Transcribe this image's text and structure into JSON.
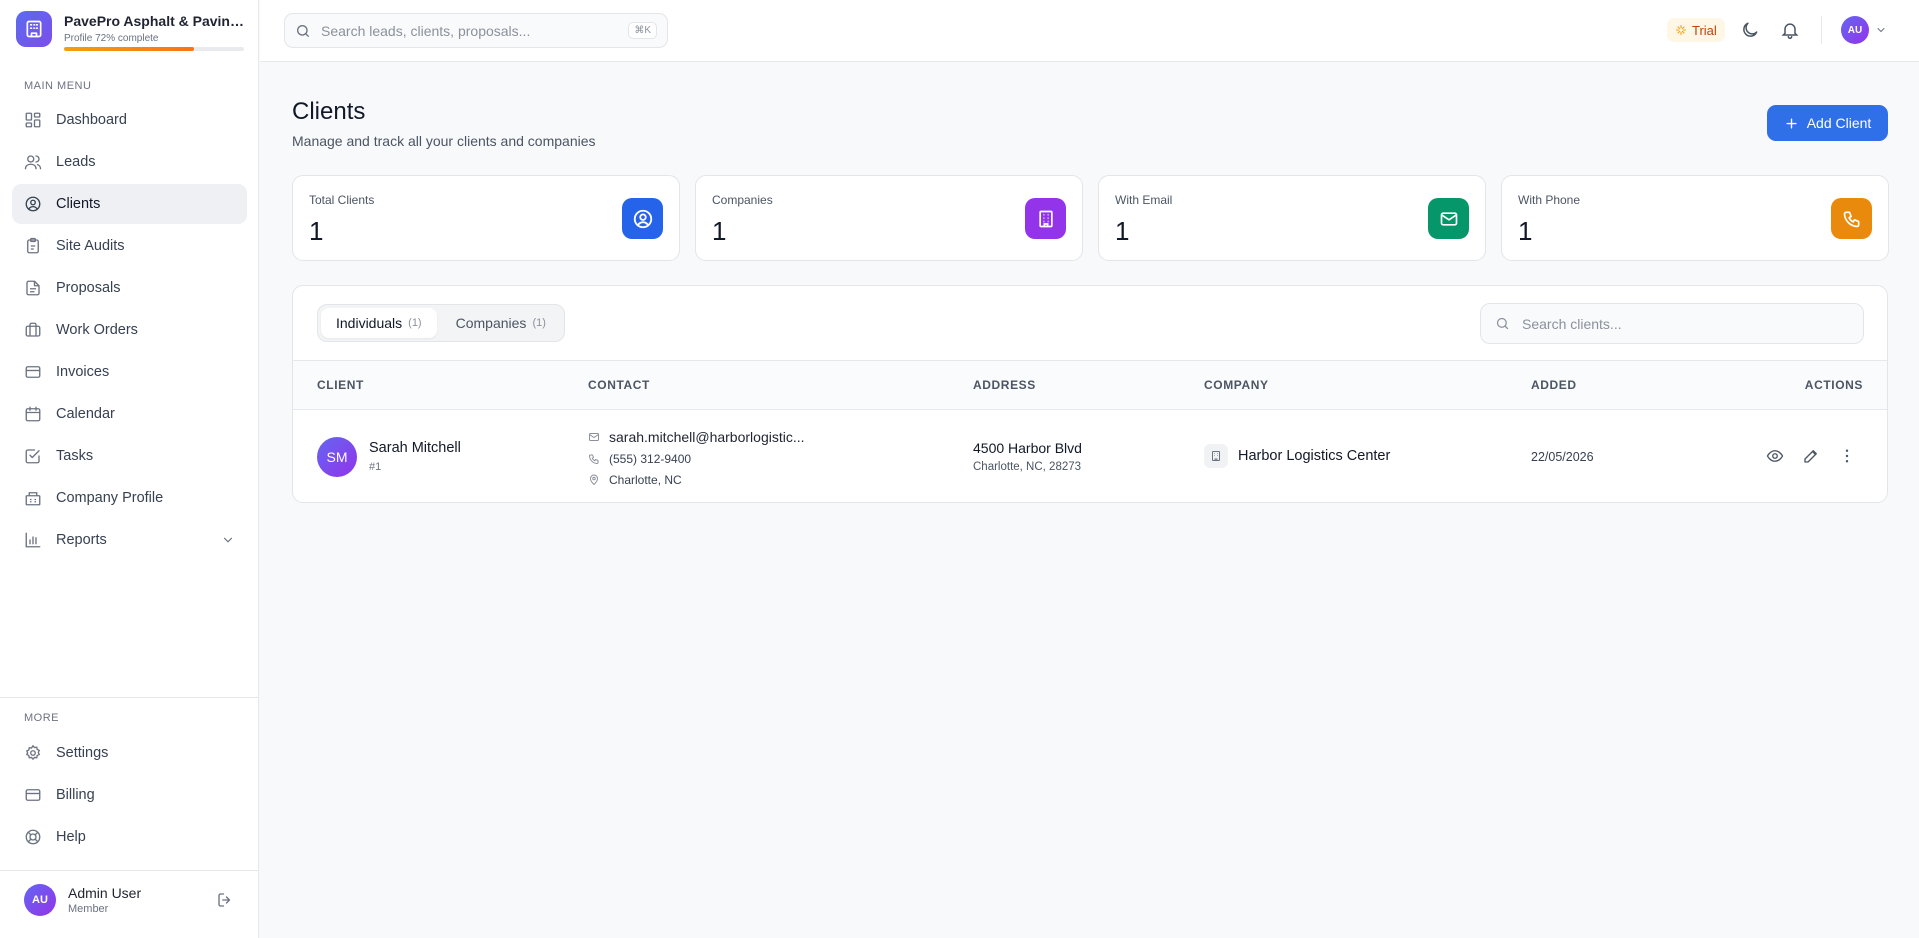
{
  "sidebar": {
    "brand_name": "PavePro Asphalt & Paving Co.",
    "profile_status": "Profile 72% complete",
    "profile_progress": 0.72,
    "main_menu_label": "MAIN MENU",
    "items": [
      {
        "label": "Dashboard",
        "icon": "dashboard-icon"
      },
      {
        "label": "Leads",
        "icon": "users-icon"
      },
      {
        "label": "Clients",
        "icon": "user-circle-icon",
        "active": true
      },
      {
        "label": "Site Audits",
        "icon": "clipboard-icon"
      },
      {
        "label": "Proposals",
        "icon": "document-icon"
      },
      {
        "label": "Work Orders",
        "icon": "briefcase-icon"
      },
      {
        "label": "Invoices",
        "icon": "credit-card-icon"
      },
      {
        "label": "Calendar",
        "icon": "calendar-icon"
      },
      {
        "label": "Tasks",
        "icon": "checklist-icon"
      },
      {
        "label": "Company Profile",
        "icon": "building-icon"
      },
      {
        "label": "Reports",
        "icon": "bar-chart-icon"
      }
    ],
    "more_label": "MORE",
    "more_items": [
      {
        "label": "Settings",
        "icon": "gear-icon"
      },
      {
        "label": "Billing",
        "icon": "credit-card-icon"
      },
      {
        "label": "Help",
        "icon": "lifebuoy-icon"
      }
    ],
    "user": {
      "initials": "AU",
      "name": "Admin User",
      "role": "Member"
    }
  },
  "topbar": {
    "search_placeholder": "Search leads, clients, proposals...",
    "shortcut": "⌘K",
    "trial_label": "Trial",
    "avatar_initials": "AU"
  },
  "page": {
    "title": "Clients",
    "subtitle": "Manage and track all your clients and companies",
    "add_button": "Add Client"
  },
  "stats": [
    {
      "label": "Total Clients",
      "value": "1",
      "color": "#2563eb"
    },
    {
      "label": "Companies",
      "value": "1",
      "color": "#9333ea"
    },
    {
      "label": "With Email",
      "value": "1",
      "color": "#059669"
    },
    {
      "label": "With Phone",
      "value": "1",
      "color": "#ea8a0c"
    }
  ],
  "table": {
    "tabs": [
      {
        "label": "Individuals",
        "count": "(1)",
        "active": true
      },
      {
        "label": "Companies",
        "count": "(1)"
      }
    ],
    "search_placeholder": "Search clients...",
    "columns": [
      "CLIENT",
      "CONTACT",
      "ADDRESS",
      "COMPANY",
      "ADDED",
      "ACTIONS"
    ],
    "rows": [
      {
        "initials": "SM",
        "name": "Sarah Mitchell",
        "id": "#1",
        "email": "sarah.mitchell@harborlogistic...",
        "phone": "(555) 312-9400",
        "location": "Charlotte, NC",
        "address_line1": "4500 Harbor Blvd",
        "address_line2": "Charlotte, NC, 28273",
        "company": "Harbor Logistics Center",
        "added": "22/05/2026"
      }
    ]
  }
}
